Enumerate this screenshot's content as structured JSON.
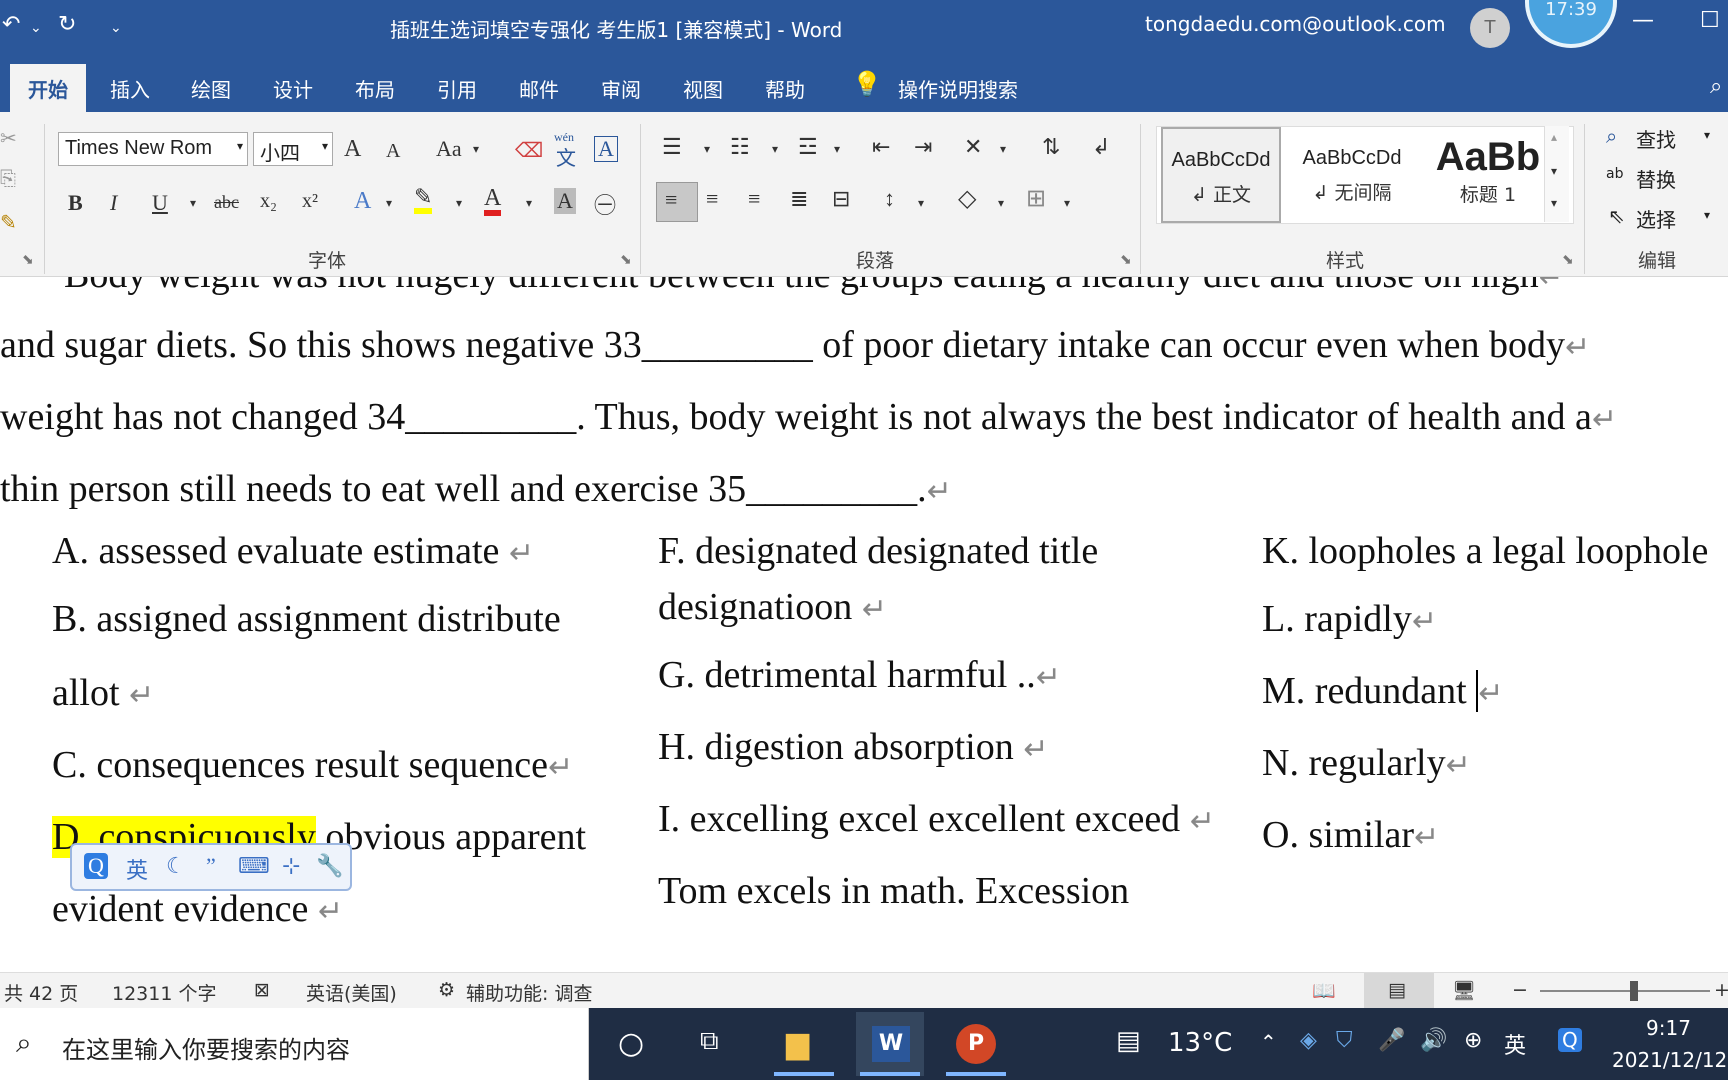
{
  "window": {
    "title": "插班生选词填空专强化 考生版1 [兼容模式]  -  Word",
    "account": "tongdaedu.com@outlook.com",
    "avatar_letter": "T",
    "clock_bubble": "17:39"
  },
  "tabs": [
    {
      "label": "开始",
      "active": true
    },
    {
      "label": "插入"
    },
    {
      "label": "绘图"
    },
    {
      "label": "设计"
    },
    {
      "label": "布局"
    },
    {
      "label": "引用"
    },
    {
      "label": "邮件"
    },
    {
      "label": "审阅"
    },
    {
      "label": "视图"
    },
    {
      "label": "帮助"
    },
    {
      "label": "操作说明搜索"
    }
  ],
  "ribbon": {
    "font_name": "Times New Rom",
    "font_size": "小四",
    "groups": {
      "font": "字体",
      "paragraph": "段落",
      "styles": "样式",
      "editing": "编辑"
    },
    "styles": [
      {
        "sample": "AaBbCcDd",
        "name": "↲ 正文"
      },
      {
        "sample": "AaBbCcDd",
        "name": "↲ 无间隔"
      },
      {
        "sample": "AaBb",
        "name": "标题 1"
      }
    ],
    "editing": {
      "find": "查找",
      "replace": "替换",
      "select": "选择"
    },
    "icons": {
      "change_case": "Aa",
      "phonetic_top": "wén",
      "phonetic_bottom": "文",
      "bold": "B",
      "italic": "I",
      "underline": "U",
      "strike": "abc",
      "subscript": "x₂",
      "superscript": "x²",
      "grow": "A",
      "shrink": "A",
      "clear": "A"
    }
  },
  "document": {
    "lines": [
      "Body weight was not hugely different between the groups eating a healthy diet and those on high",
      "and sugar diets. So this shows negative 33_________ of poor dietary intake can occur even when body",
      "weight has not changed 34_________. Thus, body weight is not always the best indicator of health and a",
      "thin person still needs to eat well and exercise 35_________."
    ],
    "options_col1": [
      "A. assessed evaluate estimate",
      "B. assigned assignment distribute",
      "allot",
      "C. consequences result sequence",
      "D. conspicuously",
      "obvious apparent",
      "evident evidence"
    ],
    "options_col2": [
      "F. designated designated title",
      "designatioon",
      "G. detrimental harmful ..",
      "H. digestion absorption",
      "I. excelling excel excellent exceed",
      "Tom excels in math. Excession"
    ],
    "options_col3": [
      "K. loopholes a legal loophole",
      "L. rapidly",
      "M. redundant",
      "N. regularly",
      "O. similar"
    ],
    "para_mark": "↵",
    "ime_toolbar": {
      "ime_lang": "英"
    }
  },
  "statusbar": {
    "pages": "共 42 页",
    "words": "12311 个字",
    "language": "英语(美国)",
    "accessibility": "辅助功能: 调查"
  },
  "taskbar": {
    "search_placeholder": "在这里输入你要搜索的内容",
    "weather": "13°C",
    "time": "9:17",
    "date": "2021/12/12",
    "ime_indicator": "英"
  },
  "colors": {
    "word_blue": "#2b579a",
    "highlight": "#ffff00",
    "taskbar": "#1f2d44"
  }
}
